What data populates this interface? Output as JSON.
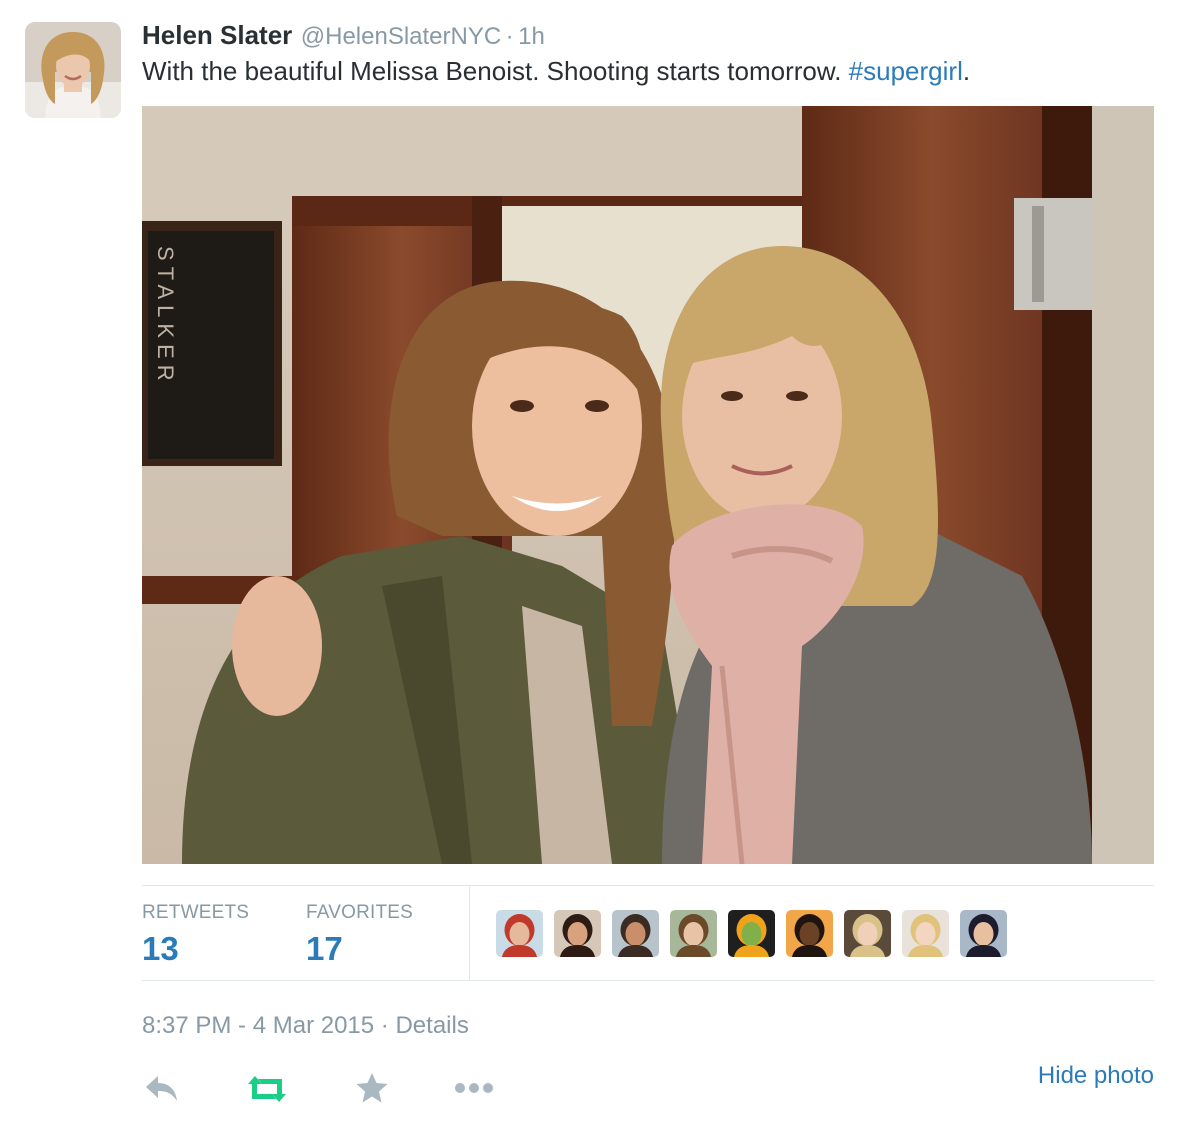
{
  "tweet": {
    "fullname": "Helen Slater",
    "username": "@HelenSlaterNYC",
    "separator": "·",
    "time": "1h",
    "text_prefix": "With the beautiful Melissa Benoist. Shooting starts tomorrow. ",
    "hashtag": "#supergirl",
    "text_suffix": ".",
    "photo_sign_text": "STALKER"
  },
  "stats": {
    "retweets_label": "RETWEETS",
    "retweets_value": "13",
    "favorites_label": "FAVORITES",
    "favorites_value": "17"
  },
  "favoriters": [
    {
      "name": "favoriter-avatar-spiderman",
      "bg": "#c9dbe6"
    },
    {
      "name": "favoriter-avatar-woman-curly",
      "bg": "#d6c8b8"
    },
    {
      "name": "favoriter-avatar-sleeping",
      "bg": "#b8c4cc"
    },
    {
      "name": "favoriter-avatar-woman-glasses",
      "bg": "#a7b89a"
    },
    {
      "name": "favoriter-avatar-cartoon",
      "bg": "#1f1f1f"
    },
    {
      "name": "favoriter-avatar-man-orange",
      "bg": "#f2a64a"
    },
    {
      "name": "favoriter-avatar-man-blond",
      "bg": "#5a4a3a"
    },
    {
      "name": "favoriter-avatar-woman-blonde",
      "bg": "#e8e2da"
    },
    {
      "name": "favoriter-avatar-superman",
      "bg": "#a9b8c8"
    }
  ],
  "meta": {
    "datetime": "8:37 PM - 4 Mar 2015",
    "separator": "·",
    "details": "Details"
  },
  "actions": {
    "reply_icon": "reply-icon",
    "retweet_icon": "retweet-icon",
    "favorite_icon": "star-icon",
    "more_icon": "more-dots-icon",
    "hide_photo": "Hide photo"
  },
  "colors": {
    "link": "#2b7bb9",
    "muted": "#8899a6",
    "text": "#292f33",
    "retweeted_green": "#19cf86",
    "icon_gray": "#aab8c2"
  }
}
